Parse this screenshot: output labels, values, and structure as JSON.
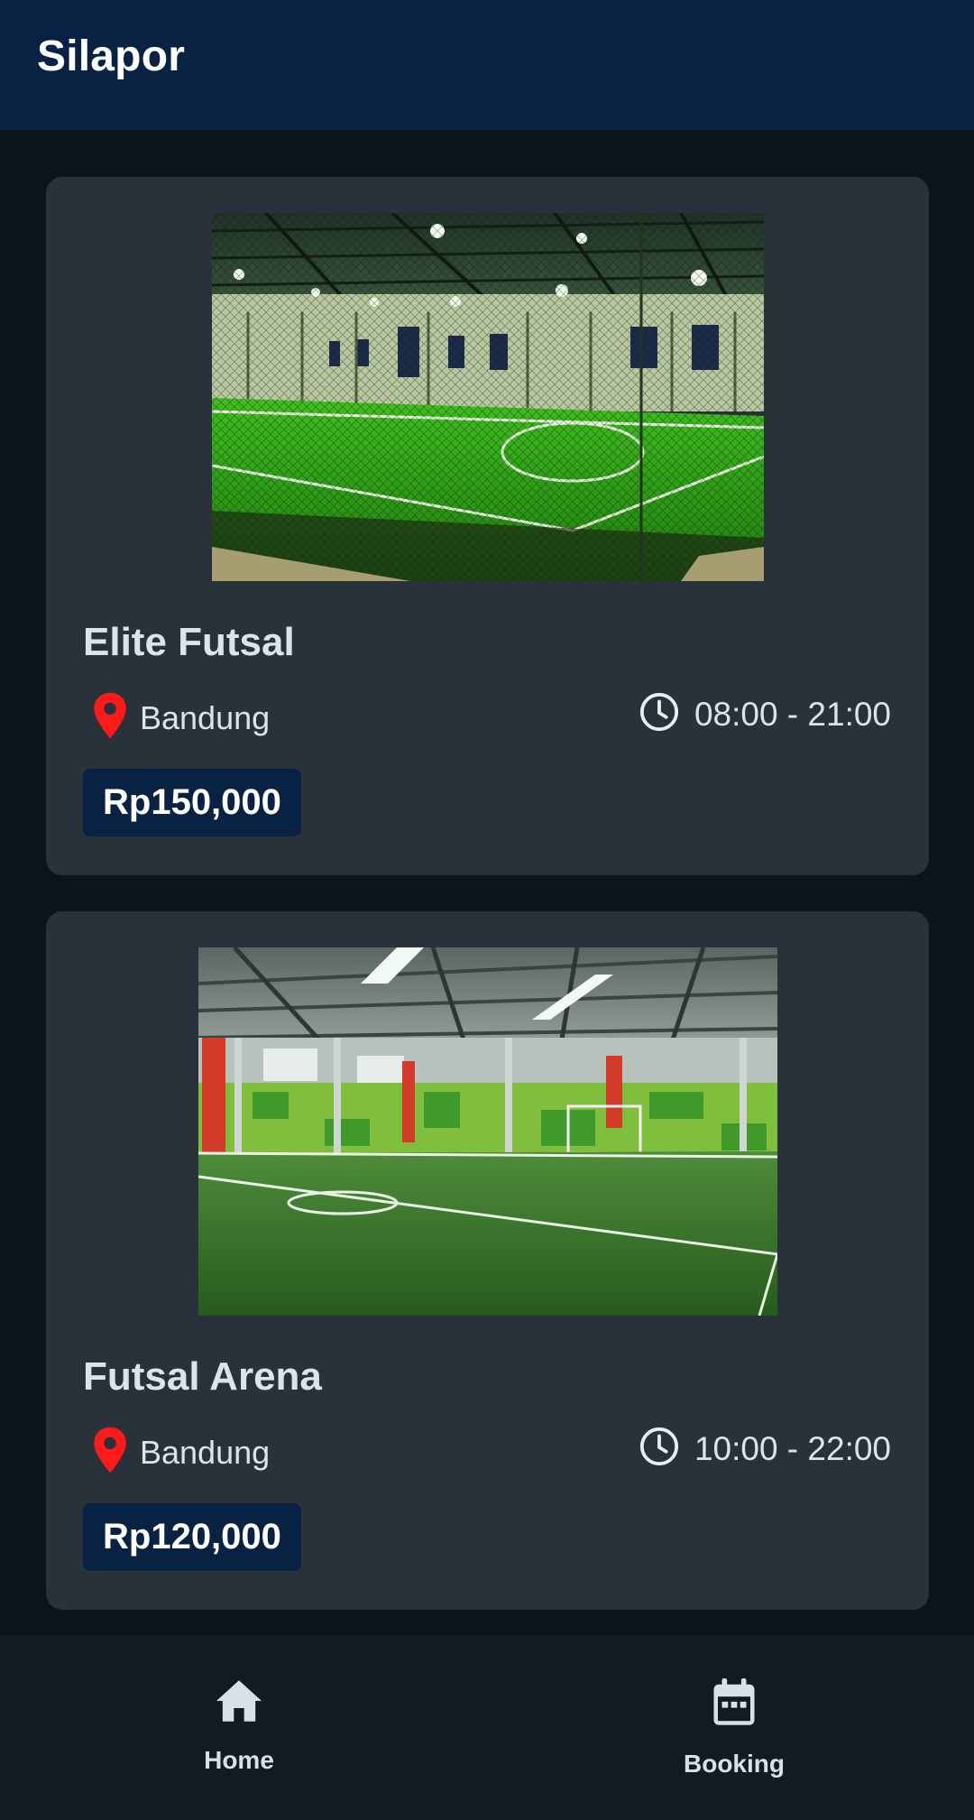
{
  "app_bar": {
    "title": "Silapor"
  },
  "venues": [
    {
      "name": "Elite Futsal",
      "location": "Bandung",
      "hours": "08:00 - 21:00",
      "price": "Rp150,000",
      "location_icon": "location-pin-icon",
      "hours_icon": "clock-icon",
      "photo": "indoor futsal court photo"
    },
    {
      "name": "Futsal Arena",
      "location": "Bandung",
      "hours": "10:00 - 22:00",
      "price": "Rp120,000",
      "location_icon": "location-pin-icon",
      "hours_icon": "clock-icon",
      "photo": "indoor futsal court photo"
    }
  ],
  "bottom_nav": {
    "items": [
      {
        "label": "Home",
        "icon": "home-icon"
      },
      {
        "label": "Booking",
        "icon": "calendar-icon"
      }
    ]
  },
  "colors": {
    "app_bar": "#082244",
    "background": "#0a141b",
    "card": "#29323a",
    "price_badge": "#082244",
    "pin": "#ff1a1a",
    "nav_bar": "#111b23"
  }
}
